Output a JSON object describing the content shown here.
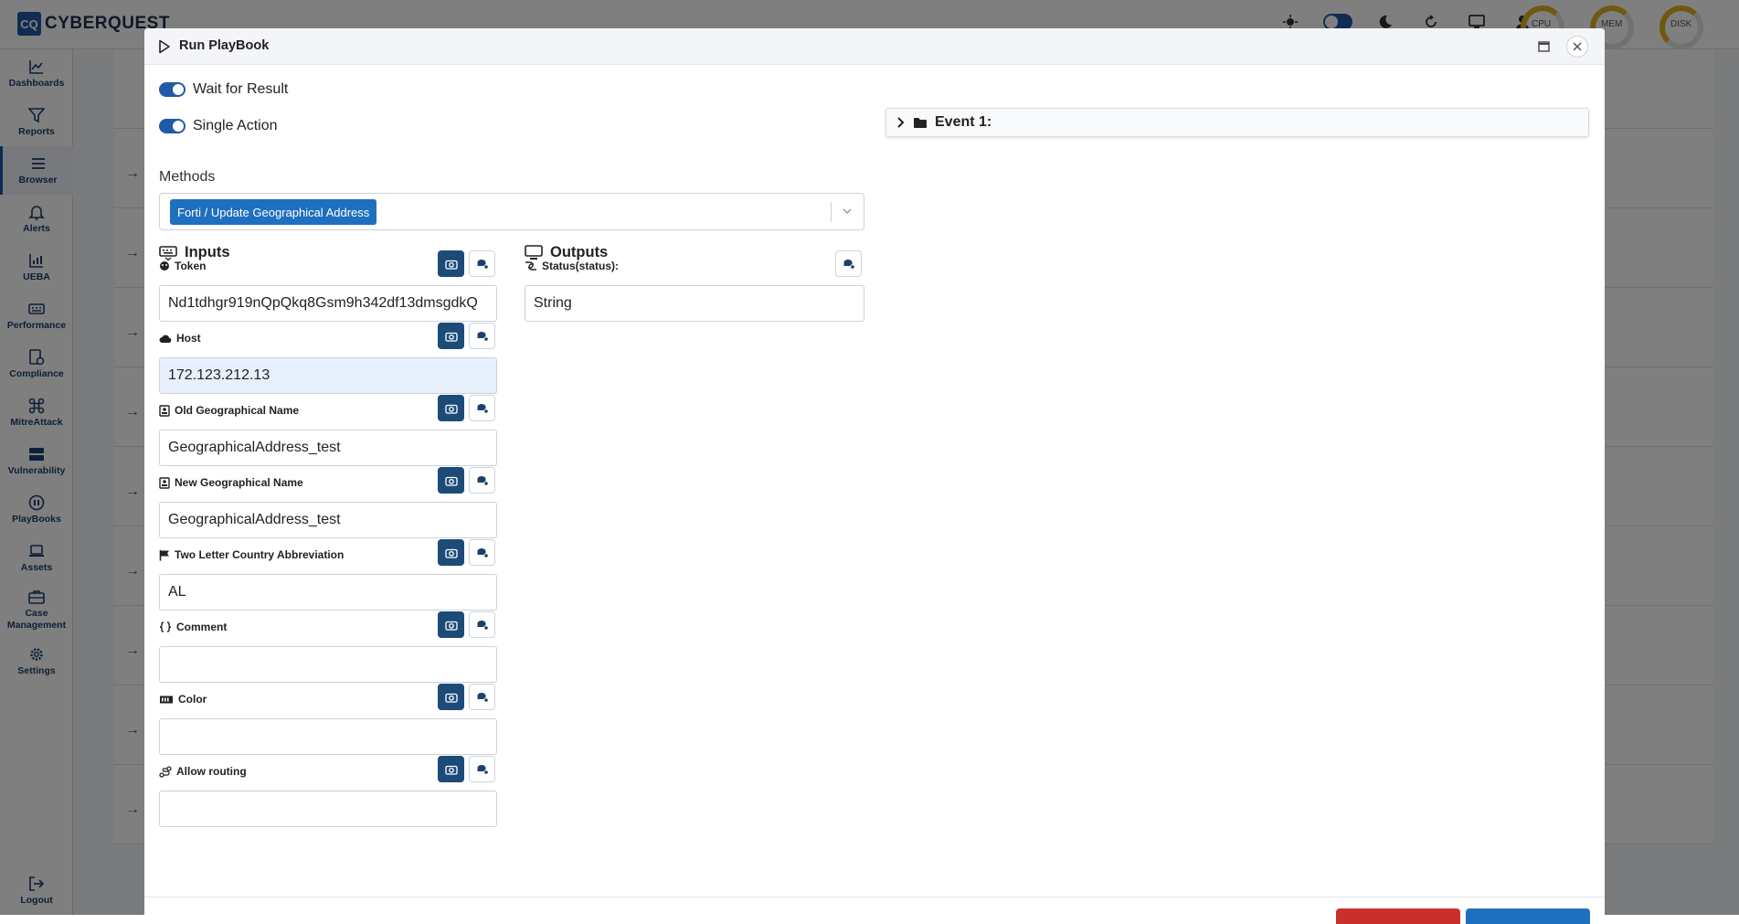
{
  "app": {
    "brand_logo": "CQ",
    "brand_name": "CYBERQUEST",
    "gauges": [
      {
        "label": "CPU"
      },
      {
        "label": "MEM"
      },
      {
        "label": "DISK"
      }
    ]
  },
  "sidebar": {
    "items": [
      {
        "label": "Dashboards",
        "icon": "chart-line-icon"
      },
      {
        "label": "Reports",
        "icon": "filter-icon"
      },
      {
        "label": "Browser",
        "icon": "list-icon"
      },
      {
        "label": "Alerts",
        "icon": "bell-icon"
      },
      {
        "label": "UEBA",
        "icon": "chart-icon"
      },
      {
        "label": "Performance",
        "icon": "keyboard-icon"
      },
      {
        "label": "Compliance",
        "icon": "compliance-icon"
      },
      {
        "label": "MitreAttack",
        "icon": "command-icon"
      },
      {
        "label": "Vulnerability",
        "icon": "server-icon"
      },
      {
        "label": "PlayBooks",
        "icon": "playbook-icon"
      },
      {
        "label": "Assets",
        "icon": "laptop-icon"
      },
      {
        "label": "Case Management",
        "icon": "briefcase-icon"
      },
      {
        "label": "Settings",
        "icon": "gear-icon"
      }
    ],
    "logout_label": "Logout"
  },
  "modal": {
    "title": "Run PlayBook",
    "wait_for_result_label": "Wait for Result",
    "single_action_label": "Single Action",
    "methods_label": "Methods",
    "selected_method": "Forti / Update Geographical Address",
    "inputs_title": "Inputs",
    "outputs_title": "Outputs",
    "event_label": "Event 1:",
    "inputs": [
      {
        "label": "Token",
        "value": "Nd1tdhgr919nQpQkq8Gsm9h342df13dmsgdkQ",
        "icon": "token-icon"
      },
      {
        "label": "Host",
        "value": "172.123.212.13",
        "icon": "cloud-icon"
      },
      {
        "label": "Old Geographical Name",
        "value": "GeographicalAddress_test",
        "icon": "id-card-icon"
      },
      {
        "label": "New Geographical Name",
        "value": "GeographicalAddress_test",
        "icon": "id-card-icon"
      },
      {
        "label": "Two Letter Country Abbreviation",
        "value": "AL",
        "icon": "flag-icon"
      },
      {
        "label": "Comment",
        "value": "",
        "icon": "braces-icon"
      },
      {
        "label": "Color",
        "value": "",
        "icon": "palette-icon"
      },
      {
        "label": "Allow routing",
        "value": "",
        "icon": "route-icon"
      }
    ],
    "outputs": [
      {
        "label": "Status(status):",
        "value": "String",
        "icon": "link-icon"
      }
    ]
  }
}
